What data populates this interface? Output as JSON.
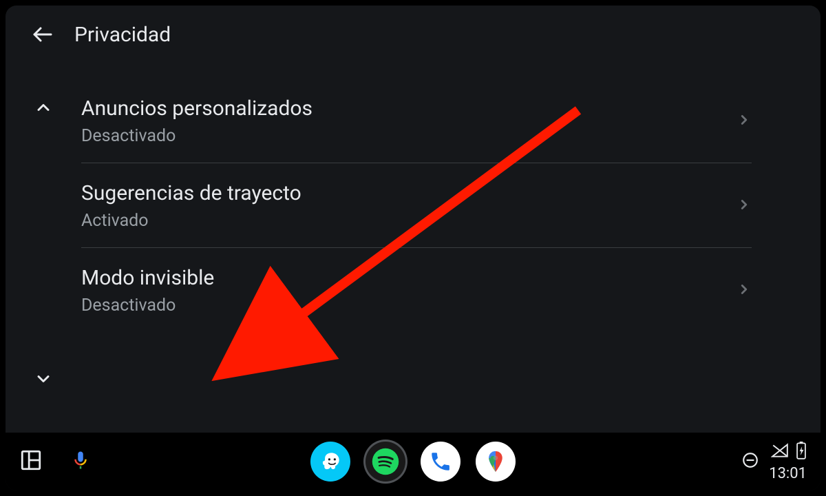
{
  "header": {
    "title": "Privacidad"
  },
  "items": [
    {
      "title": "Anuncios personalizados",
      "sub": "Desactivado"
    },
    {
      "title": "Sugerencias de trayecto",
      "sub": "Activado"
    },
    {
      "title": "Modo invisible",
      "sub": "Desactivado"
    }
  ],
  "nav": {
    "apps": [
      "waze",
      "spotify",
      "phone",
      "gmaps"
    ],
    "time": "13:01"
  },
  "annotation": {
    "type": "arrow",
    "color": "#ff1a00",
    "target_item_index": 2
  }
}
